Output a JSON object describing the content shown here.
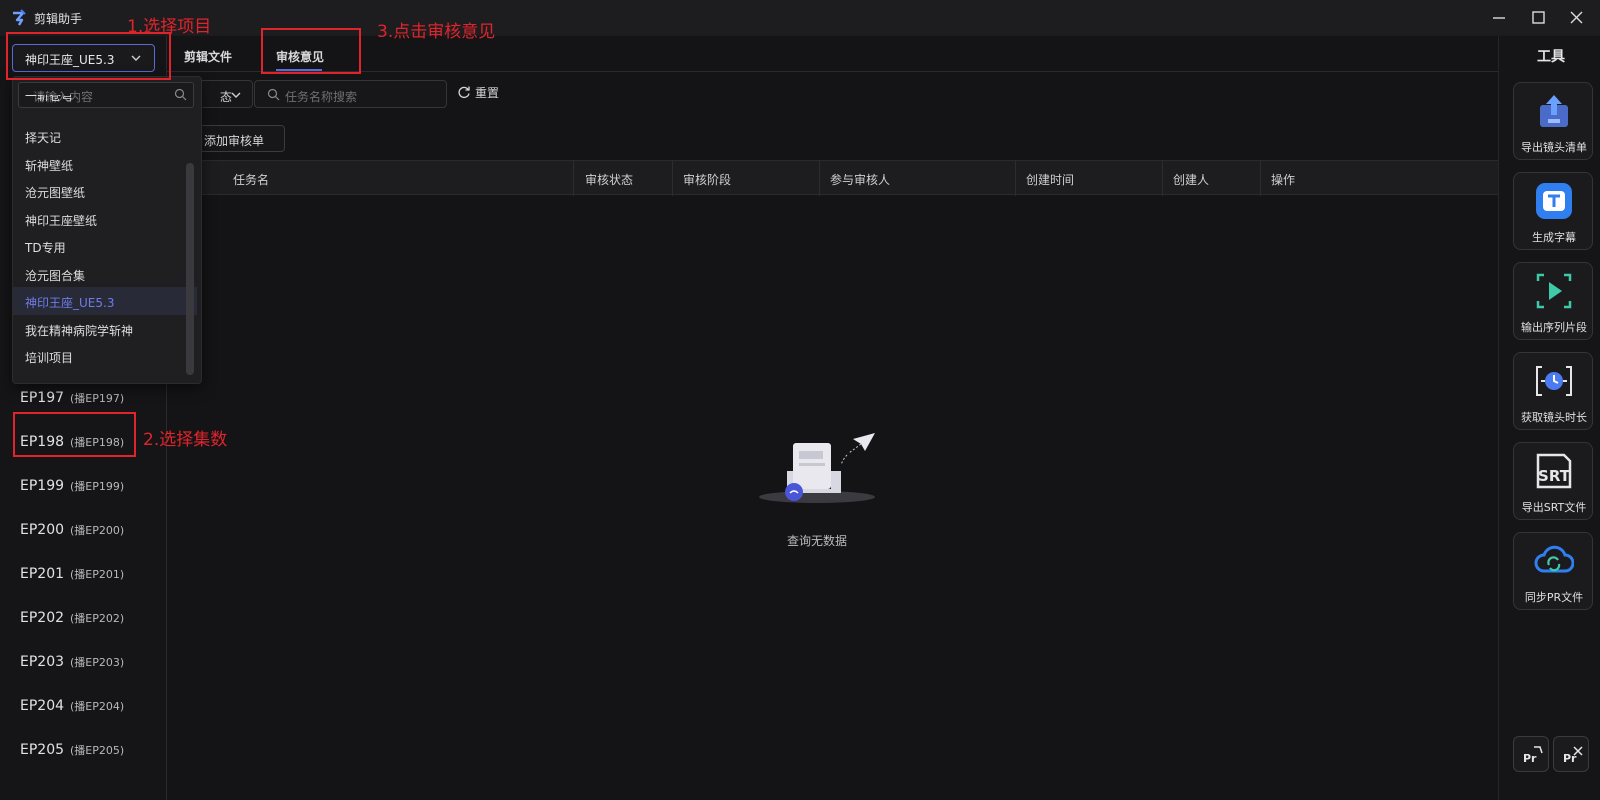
{
  "app": {
    "title": "剪辑助手"
  },
  "sidebar": {
    "project_selected": "神印王座_UE5.3",
    "episodes": [
      {
        "label": "EP197",
        "sub": "(播EP197)"
      },
      {
        "label": "EP198",
        "sub": "(播EP198)"
      },
      {
        "label": "EP199",
        "sub": "(播EP199)"
      },
      {
        "label": "EP200",
        "sub": "(播EP200)"
      },
      {
        "label": "EP201",
        "sub": "(播EP201)"
      },
      {
        "label": "EP202",
        "sub": "(播EP202)"
      },
      {
        "label": "EP203",
        "sub": "(播EP203)"
      },
      {
        "label": "EP204",
        "sub": "(播EP204)"
      },
      {
        "label": "EP205",
        "sub": "(播EP205)"
      }
    ]
  },
  "dropdown": {
    "search_placeholder": "请输入内容",
    "options": [
      "一斩苍穹",
      "择天记",
      "斩神壁纸",
      "沧元图壁纸",
      "神印王座壁纸",
      "TD专用",
      "沧元图合集",
      "神印王座_UE5.3",
      "我在精神病院学斩神",
      "培训项目"
    ],
    "selected": "神印王座_UE5.3"
  },
  "tabs": {
    "items": [
      "剪辑文件",
      "审核意见"
    ],
    "active": "审核意见"
  },
  "filters": {
    "status_label": "态",
    "search_placeholder": "任务名称搜索",
    "reset_label": "重置",
    "add_button": "添加审核单"
  },
  "table": {
    "columns": [
      "任务名",
      "审核状态",
      "审核阶段",
      "参与审核人",
      "创建时间",
      "创建人",
      "操作"
    ],
    "rows": [],
    "empty_text": "查询无数据"
  },
  "tools": {
    "title": "工具",
    "items": [
      {
        "label": "导出镜头清单",
        "icon": "export-shot-list-icon"
      },
      {
        "label": "生成字幕",
        "icon": "subtitle-icon"
      },
      {
        "label": "输出序列片段",
        "icon": "sequence-output-icon"
      },
      {
        "label": "获取镜头时长",
        "icon": "shot-duration-icon"
      },
      {
        "label": "导出SRT文件",
        "icon": "srt-icon"
      },
      {
        "label": "同步PR文件",
        "icon": "cloud-sync-icon"
      }
    ]
  },
  "annotations": {
    "step1": "1.选择项目",
    "step2": "2.选择集数",
    "step3": "3.点击审核意见"
  },
  "colors": {
    "accent": "#5a6ad6",
    "annotation": "#e0242b"
  }
}
